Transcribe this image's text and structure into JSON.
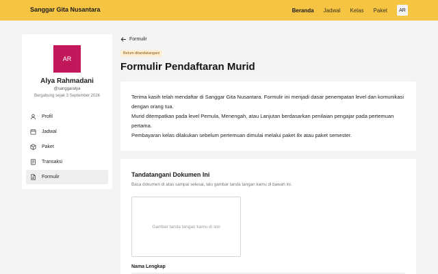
{
  "header": {
    "brand": "Sanggar Gita Nusantara",
    "nav": [
      "Beranda",
      "Jadwal",
      "Kelas",
      "Paket"
    ],
    "avatar_initials": "AR",
    "bg_color": "#f6c443"
  },
  "profile": {
    "initials": "AR",
    "name": "Alya Rahmadani",
    "handle": "@sanggaralya",
    "joined": "Bergabung sejak 3 September 2026",
    "avatar_color": "#c2185b"
  },
  "sidebar": {
    "items": [
      {
        "label": "Profil",
        "icon": "user-icon"
      },
      {
        "label": "Jadwal",
        "icon": "calendar-icon"
      },
      {
        "label": "Paket",
        "icon": "package-icon"
      },
      {
        "label": "Transaksi",
        "icon": "receipt-icon"
      },
      {
        "label": "Formulir",
        "icon": "document-icon",
        "active": true
      }
    ]
  },
  "page": {
    "back_label": "Formulir",
    "status_badge": "Belum ditandatangani",
    "title": "Formulir Pendaftaran Murid",
    "paragraphs": [
      "Terima kasih telah mendaftar di Sanggar Gita Nusantara. Formulir ini menjadi dasar penempatan level dan komunikasi dengan orang tua.",
      "Murid ditempatkan pada level Pemula, Menengah, atau Lanjutan berdasarkan penilaian pengajar pada pertemuan pertama.",
      "Pembayaran kelas dilakukan sebelum pertemuan dimulai melalui paket 8x atau paket semester."
    ]
  },
  "signature": {
    "title": "Tandatangani Dokumen Ini",
    "description": "Baca dokumen di atas sampai selesai, lalu gambar tanda tangan kamu di bawah ini.",
    "pad_placeholder": "Gambar tanda tangan kamu di sini",
    "name_label": "Nama Lengkap",
    "name_value": ""
  }
}
